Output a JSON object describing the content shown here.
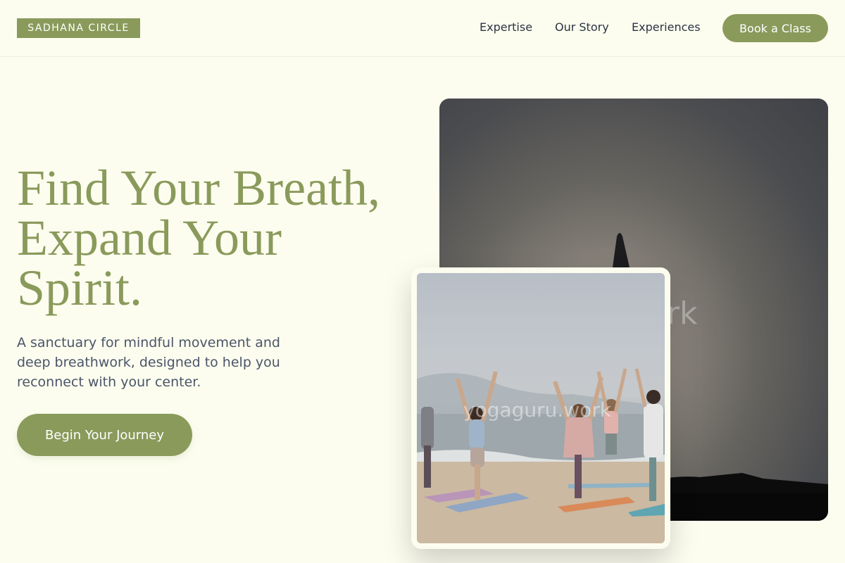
{
  "brand": {
    "logo_text": "SADHANA CIRCLE",
    "accent": "#8a9a5b",
    "background": "#fcfdef"
  },
  "nav": {
    "links": [
      "Expertise",
      "Our Story",
      "Experiences"
    ],
    "book_label": "Book a Class"
  },
  "hero": {
    "title_lines": [
      "Find Your Breath,",
      "Expand Your",
      "Spirit."
    ],
    "subtitle_lines": [
      "A sanctuary for mindful movement and",
      "deep breathwork, designed to help you",
      "reconnect with your center."
    ],
    "cta_label": "Begin Your Journey"
  },
  "images": {
    "main_watermark": "work",
    "card_watermark": "yogaguru.work"
  }
}
